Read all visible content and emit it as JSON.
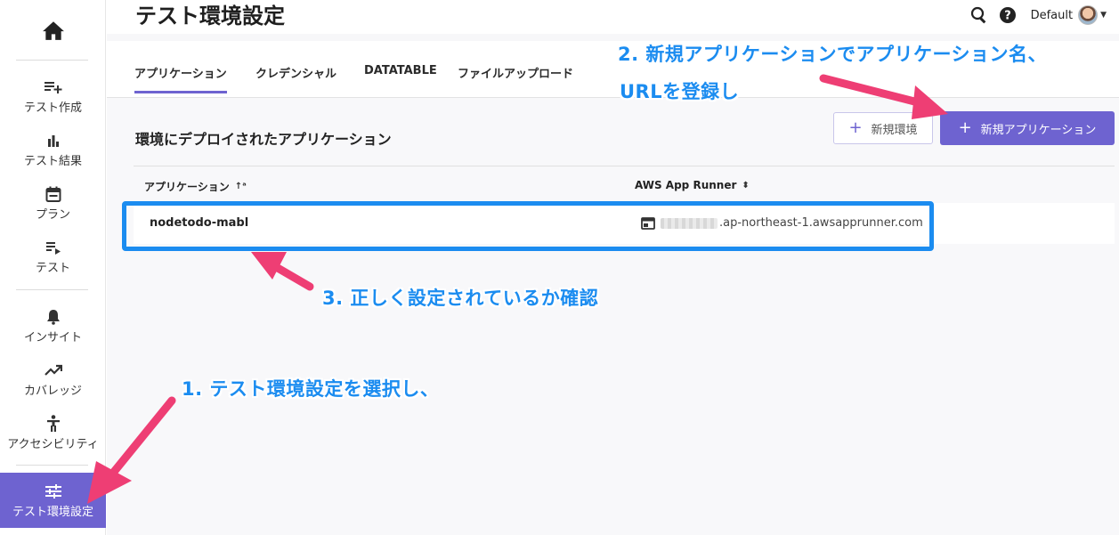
{
  "page": {
    "title": "テスト環境設定"
  },
  "header": {
    "search_icon": "search-icon",
    "help_icon": "help-icon",
    "workspace": "Default"
  },
  "sidebar": {
    "home_icon": "home-icon",
    "items": [
      {
        "label": "テスト作成",
        "icon": "playlist-add-icon"
      },
      {
        "label": "テスト結果",
        "icon": "bar-chart-icon"
      },
      {
        "label": "プラン",
        "icon": "calendar-icon"
      },
      {
        "label": "テスト",
        "icon": "list-play-icon"
      },
      {
        "label": "インサイト",
        "icon": "bell-icon"
      },
      {
        "label": "カバレッジ",
        "icon": "trending-up-icon"
      },
      {
        "label": "アクセシビリティ",
        "icon": "accessibility-icon"
      },
      {
        "label": "テスト環境設定",
        "icon": "tune-icon",
        "active": true
      }
    ]
  },
  "tabs": [
    "アプリケーション",
    "クレデンシャル",
    "DATATABLE",
    "ファイルアップロード"
  ],
  "section": {
    "title": "環境にデプロイされたアプリケーション"
  },
  "buttons": {
    "new_env": "新規環境",
    "new_app": "新規アプリケーション"
  },
  "table": {
    "columns": [
      "アプリケーション",
      "AWS App Runner"
    ],
    "rows": [
      {
        "app": "nodetodo-mabl",
        "url_suffix": ".ap-northeast-1.awsapprunner.com"
      }
    ]
  },
  "annotations": {
    "step1": "1. テスト環境設定を選択し、",
    "step2_line1": "2. 新規アプリケーションでアプリケーション名、",
    "step2_line2": "URLを登録し",
    "step3": "3. 正しく設定されているか確認",
    "color": "#1b8cf0",
    "arrow_color": "#ee3e74"
  },
  "theme": {
    "accent": "#6e63d0",
    "background": "#f8f8fa"
  }
}
